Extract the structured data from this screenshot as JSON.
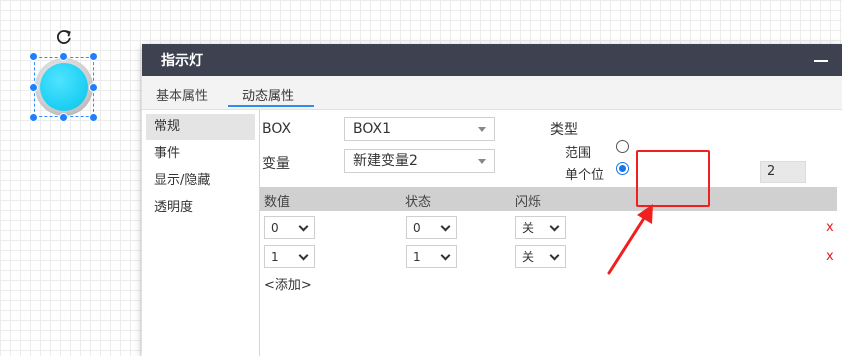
{
  "dialog": {
    "title": "指示灯",
    "tabs": [
      "基本属性",
      "动态属性"
    ],
    "active_tab": "动态属性"
  },
  "side_nav": [
    {
      "label": "常规",
      "active": true
    },
    {
      "label": "事件",
      "active": false
    },
    {
      "label": "显示/隐藏",
      "active": false
    },
    {
      "label": "透明度",
      "active": false
    }
  ],
  "general": {
    "box_label": "BOX",
    "box_value": "BOX1",
    "var_label": "变量",
    "var_value": "新建变量2",
    "type_label": "类型",
    "range_label": "范围",
    "single_bit_label": "单个位",
    "single_bit_selected": true,
    "bit_value": "2"
  },
  "table": {
    "headers": [
      "数值",
      "状态",
      "闪烁"
    ],
    "rows": [
      {
        "value": "0",
        "state": "0",
        "blink": "关",
        "delete": "x"
      },
      {
        "value": "1",
        "state": "1",
        "blink": "关",
        "delete": "x"
      }
    ],
    "add_label": "<添加>"
  },
  "colors": {
    "title_bar": "#3d4150",
    "lamp": "#22d1f5",
    "accent": "#2d8cf0",
    "annotation": "#f02020",
    "delete": "#e02020"
  },
  "icons": {
    "rotate": "rotate-icon",
    "minimize": "minimize-icon",
    "dropdown": "chevron-down-icon"
  }
}
